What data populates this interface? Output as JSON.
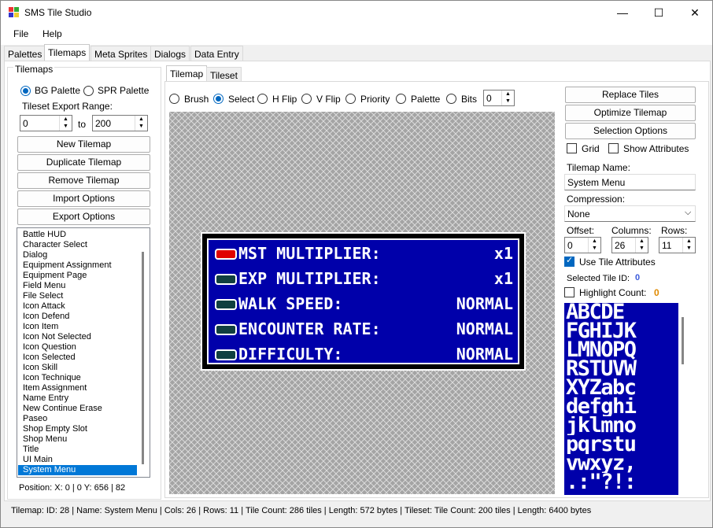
{
  "window": {
    "title": "SMS Tile Studio",
    "minimize": "—",
    "maximize": "☐",
    "close": "✕"
  },
  "menu": [
    "File",
    "Help"
  ],
  "tabs": [
    "Palettes",
    "Tilemaps",
    "Meta Sprites",
    "Dialogs",
    "Data Entry"
  ],
  "left": {
    "group_label": "Tilemaps",
    "bg_palette": "BG Palette",
    "spr_palette": "SPR Palette",
    "export_range_label": "Tileset Export Range:",
    "range_from": "0",
    "range_to_label": "to",
    "range_to": "200",
    "buttons": [
      "New Tilemap",
      "Duplicate Tilemap",
      "Remove Tilemap",
      "Import Options",
      "Export Options"
    ],
    "list": [
      "Battle HUD",
      "Character Select",
      "Dialog",
      "Equipment Assignment",
      "Equipment Page",
      "Field Menu",
      "File Select",
      "Icon Attack",
      "Icon Defend",
      "Icon Item",
      "Icon Not Selected",
      "Icon Question",
      "Icon Selected",
      "Icon Skill",
      "Icon Technique",
      "Item Assignment",
      "Name Entry",
      "New Continue Erase",
      "Paseo",
      "Shop Empty Slot",
      "Shop Menu",
      "Title",
      "UI Main",
      "System Menu"
    ],
    "selected_item": "System Menu",
    "position": "Position: X: 0 | 0 Y: 656 | 82"
  },
  "subtabs": [
    "Tilemap",
    "Tileset"
  ],
  "tools": [
    "Brush",
    "Select",
    "H Flip",
    "V Flip",
    "Priority",
    "Palette",
    "Bits"
  ],
  "bits_value": "0",
  "preview": {
    "rows": [
      {
        "label": "MST  MULTIPLIER:",
        "value": "x1",
        "active": true
      },
      {
        "label": "EXP  MULTIPLIER:",
        "value": "x1",
        "active": false
      },
      {
        "label": "WALK  SPEED:",
        "value": "NORMAL",
        "active": false
      },
      {
        "label": "ENCOUNTER  RATE:",
        "value": "NORMAL",
        "active": false
      },
      {
        "label": "DIFFICULTY:",
        "value": "NORMAL",
        "active": false
      }
    ]
  },
  "right": {
    "buttons": [
      "Replace Tiles",
      "Optimize Tilemap",
      "Selection Options"
    ],
    "grid": "Grid",
    "show_attributes": "Show Attributes",
    "name_label": "Tilemap Name:",
    "name_value": "System Menu",
    "compression_label": "Compression:",
    "compression_value": "None",
    "offset_label": "Offset:",
    "offset_value": "0",
    "columns_label": "Columns:",
    "columns_value": "26",
    "rows_label": "Rows:",
    "rows_value": "11",
    "use_tile_attributes": "Use Tile Attributes",
    "selected_tile_label": "Selected Tile ID:",
    "selected_tile_value": "0",
    "highlight_label": "Highlight Count:",
    "highlight_value": "0",
    "tileset_rows": [
      "ABCDE",
      "FGHIJK",
      "LMNOPQ",
      "RSTUVW",
      "XYZabc",
      "defghi",
      "jklmno",
      "pqrstu",
      "vwxyz,",
      ".:\"?!:"
    ]
  },
  "status": "Tilemap: ID: 28 | Name: System Menu | Cols: 26 | Rows: 11 | Tile Count: 286 tiles | Length: 572 bytes | Tileset: Tile Count: 200 tiles | Length: 6400 bytes",
  "colors": {
    "accent": "#0078d7",
    "sms_blue": "#0000aa",
    "cursor_red": "#e00000",
    "id_blue": "#3b5bdb",
    "count_orange": "#e08a00"
  }
}
